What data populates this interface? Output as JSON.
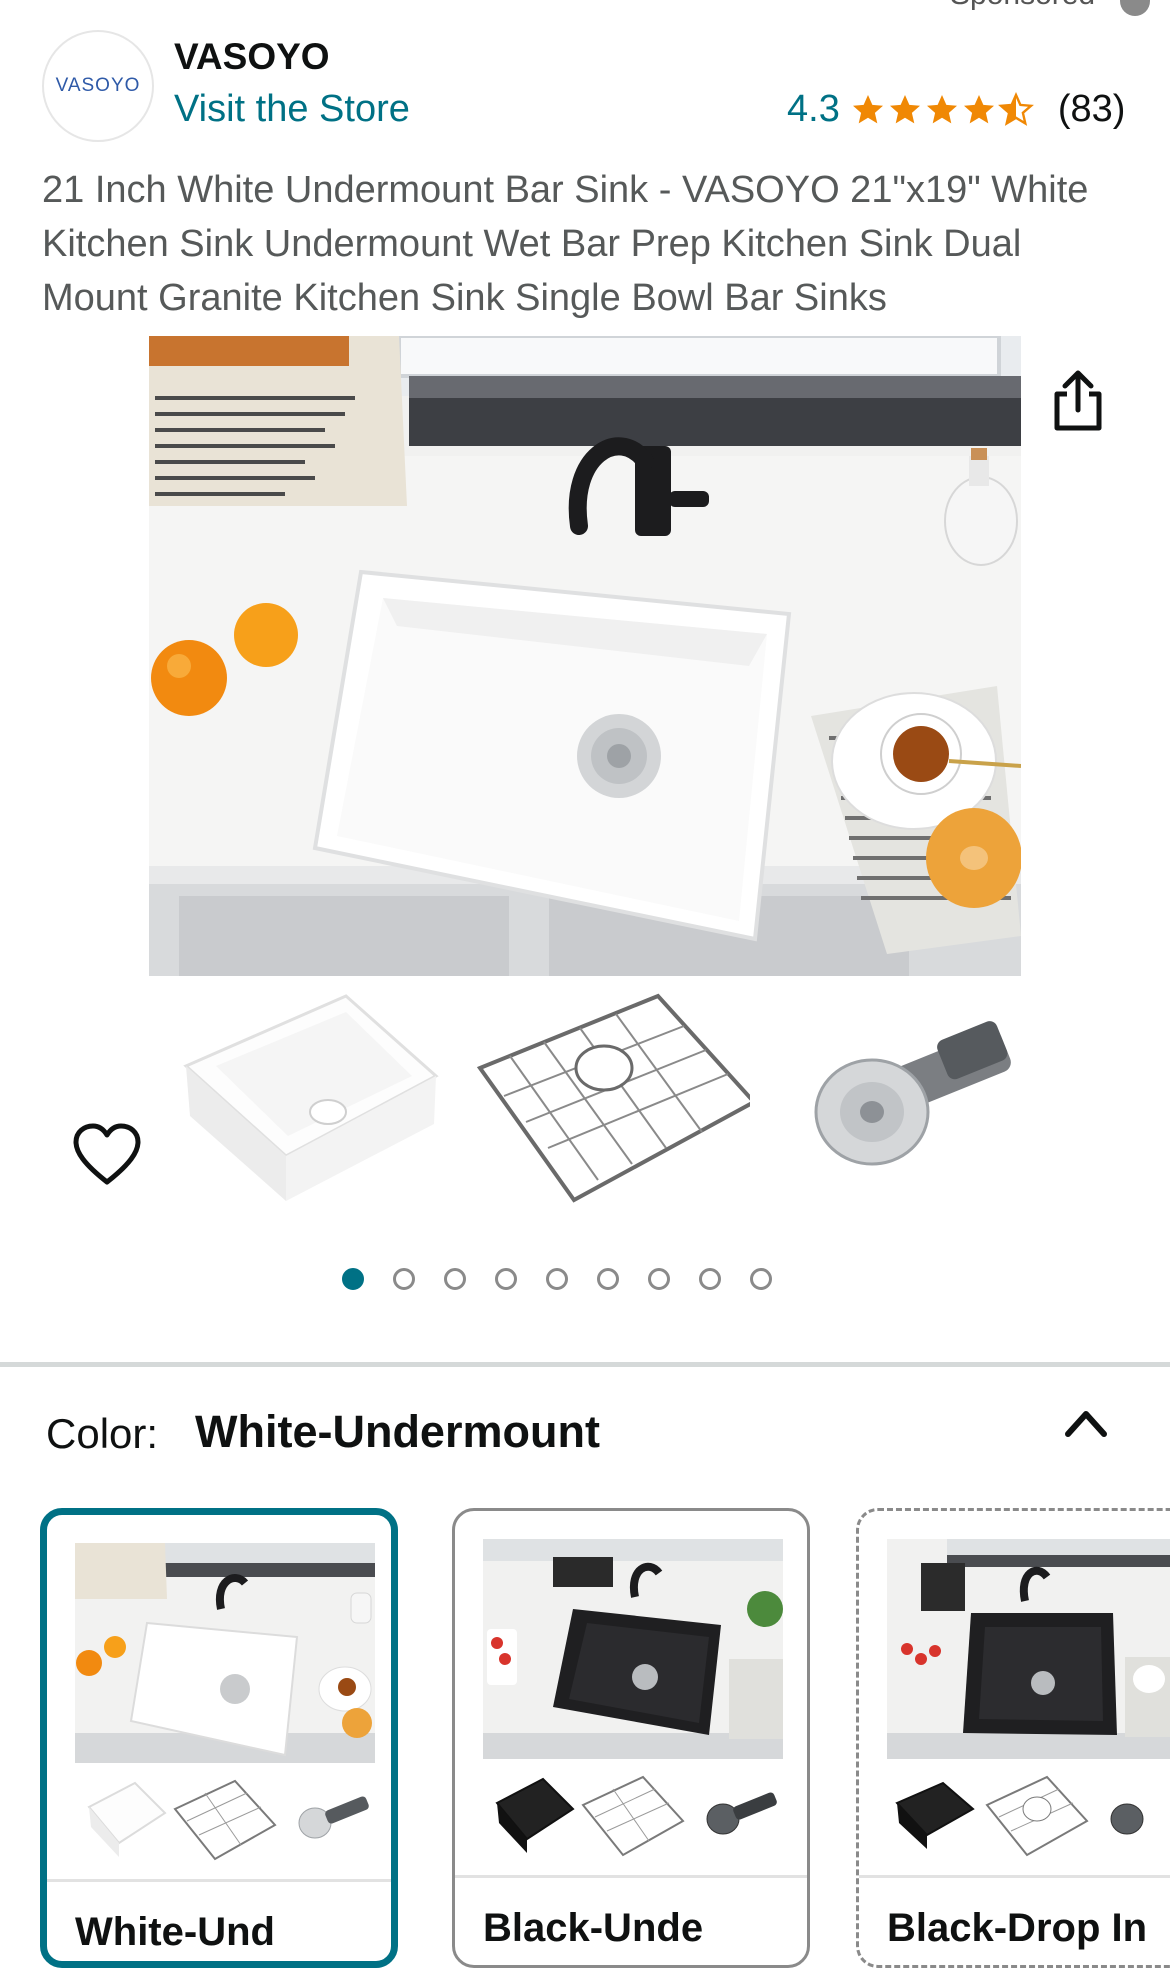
{
  "header": {
    "sponsored_label": "Sponsored",
    "brand_logo_text": "VASOYO",
    "brand_name": "VASOYO",
    "visit_store": "Visit the Store",
    "rating": "4.3",
    "rating_stars": 4.3,
    "review_count": "(83)"
  },
  "product": {
    "title": "21 Inch White Undermount Bar Sink - VASOYO 21\"x19\" White Kitchen Sink Undermount Wet Bar Prep Kitchen Sink Dual Mount Granite Kitchen Sink Single Bowl Bar Sinks",
    "icons": [
      "share-icon",
      "heart-icon"
    ],
    "thumbnails": [
      "white-sink-thumbnail",
      "sink-grid-thumbnail",
      "strainer-thumbnail"
    ],
    "image_count": 9,
    "active_image": 1
  },
  "color_selector": {
    "label": "Color:",
    "value": "White-Undermount",
    "options": [
      {
        "label": "White-Und",
        "selected": true
      },
      {
        "label": "Black-Unde",
        "selected": false
      },
      {
        "label": "Black-Drop In",
        "selected": false
      }
    ]
  },
  "colors": {
    "link": "#007185",
    "star": "#f08804",
    "border": "#d5d9d9"
  }
}
